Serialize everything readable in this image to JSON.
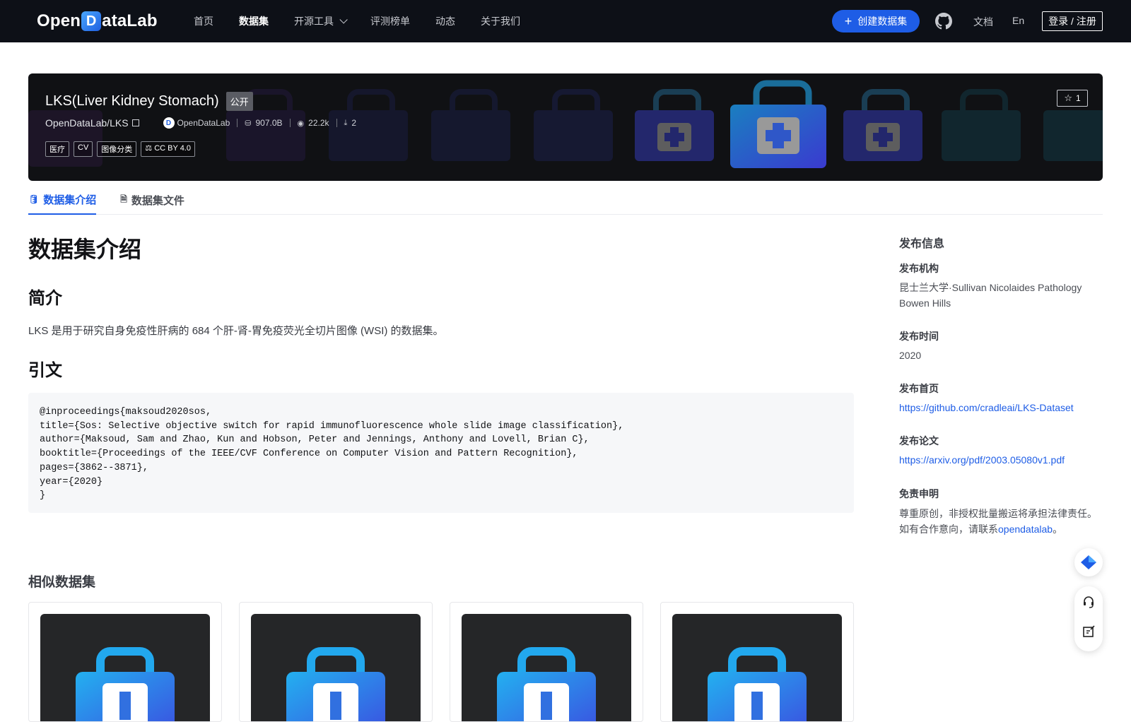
{
  "navbar": {
    "logo_left": "Open",
    "logo_d": "D",
    "logo_right": "ataLab",
    "items": [
      {
        "label": "首页",
        "active": false
      },
      {
        "label": "数据集",
        "active": true
      },
      {
        "label": "开源工具",
        "active": false,
        "dropdown": true
      },
      {
        "label": "评测榜单",
        "active": false
      },
      {
        "label": "动态",
        "active": false
      },
      {
        "label": "关于我们",
        "active": false
      }
    ],
    "create_label": "创建数据集",
    "docs_label": "文档",
    "lang_label": "En",
    "login_label": "登录 / 注册",
    "github_icon": "github-icon"
  },
  "banner": {
    "title": "LKS(Liver Kidney Stomach)",
    "visibility": "公开",
    "path": "OpenDataLab/LKS",
    "owner": "OpenDataLab",
    "size": "907.0B",
    "views": "22.2k",
    "downloads": "2",
    "tags": [
      "医疗",
      "CV",
      "图像分类"
    ],
    "license": "CC BY 4.0",
    "stars": "1"
  },
  "tabs": [
    {
      "label": "数据集介绍",
      "active": true,
      "icon": "database-icon"
    },
    {
      "label": "数据集文件",
      "active": false,
      "icon": "file-icon"
    }
  ],
  "content": {
    "main_title": "数据集介绍",
    "intro_heading": "简介",
    "intro_text": "LKS 是用于研究自身免疫性肝病的 684 个肝-肾-胃免疫荧光全切片图像 (WSI) 的数据集。",
    "citation_heading": "引文",
    "citation": "@inproceedings{maksoud2020sos,\ntitle={Sos: Selective objective switch for rapid immunofluorescence whole slide image classification},\nauthor={Maksoud, Sam and Zhao, Kun and Hobson, Peter and Jennings, Anthony and Lovell, Brian C},\nbooktitle={Proceedings of the IEEE/CVF Conference on Computer Vision and Pattern Recognition},\npages={3862--3871},\nyear={2020}\n}",
    "similar_heading": "相似数据集"
  },
  "sidebar": {
    "title": "发布信息",
    "org_label": "发布机构",
    "org_value": "昆士兰大学·Sullivan Nicolaides Pathology Bowen Hills",
    "time_label": "发布时间",
    "time_value": "2020",
    "home_label": "发布首页",
    "home_value": "https://github.com/cradleai/LKS-Dataset",
    "paper_label": "发布论文",
    "paper_value": "https://arxiv.org/pdf/2003.05080v1.pdf",
    "disclaimer_label": "免责申明",
    "disclaimer_line1": "尊重原创，非授权批量搬运将承担法律责任。",
    "disclaimer_line2_prefix": "如有合作意向，请联系",
    "disclaimer_link": "opendatalab",
    "disclaimer_suffix": "。"
  },
  "colors": {
    "accent": "#1e5de6",
    "navbar_bg": "#0d1017",
    "banner_bg": "#101114"
  }
}
